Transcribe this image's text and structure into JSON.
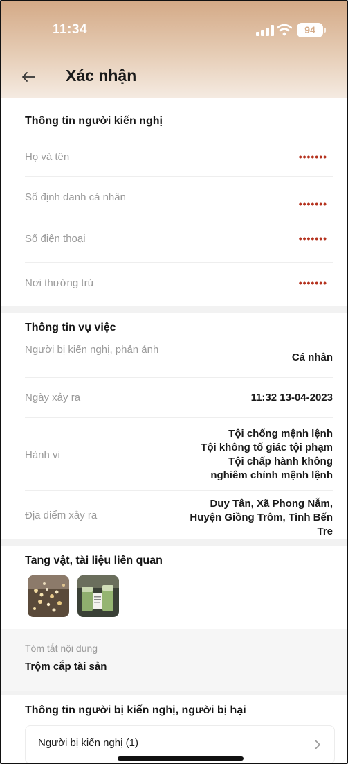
{
  "status_bar": {
    "time": "11:34",
    "battery": "94"
  },
  "header": {
    "title": "Xác nhận"
  },
  "petitioner": {
    "title": "Thông tin người kiến nghị",
    "rows": [
      {
        "label": "Họ và tên",
        "value": "•••••••"
      },
      {
        "label": "Số định danh cá nhân",
        "value": "•••••••"
      },
      {
        "label": "Số điện thoại",
        "value": "•••••••"
      },
      {
        "label": "Nơi thường trú",
        "value": "•••••••"
      }
    ]
  },
  "case": {
    "title": "Thông tin vụ việc",
    "subject_label": "Người bị kiến nghị, phản ánh",
    "subject_value": "Cá nhân",
    "date_label": "Ngày xảy ra",
    "date_value": "11:32 13-04-2023",
    "behavior_label": "Hành vi",
    "behavior_values": [
      "Tội chống mệnh lệnh",
      "Tội không tố giác tội phạm",
      "Tội chấp hành không",
      "nghiêm chỉnh mệnh lệnh"
    ],
    "location_label": "Địa điểm xảy ra",
    "location_values": [
      "Duy Tân, Xã Phong Nẫm,",
      "Huyện Giồng Trôm, Tỉnh Bến",
      "Tre"
    ]
  },
  "evidence": {
    "title": "Tang vật, tài liệu liên quan"
  },
  "summary": {
    "label": "Tóm tắt nội dung",
    "value": "Trộm cắp tài sản"
  },
  "parties": {
    "title": "Thông tin người bị kiến nghị, người bị hại",
    "item_label": "Người bị kiến nghị (1)"
  },
  "colors": {
    "header_top": "#d4aa87",
    "masked": "#b5321e",
    "background_gap": "#f2f2f2"
  }
}
